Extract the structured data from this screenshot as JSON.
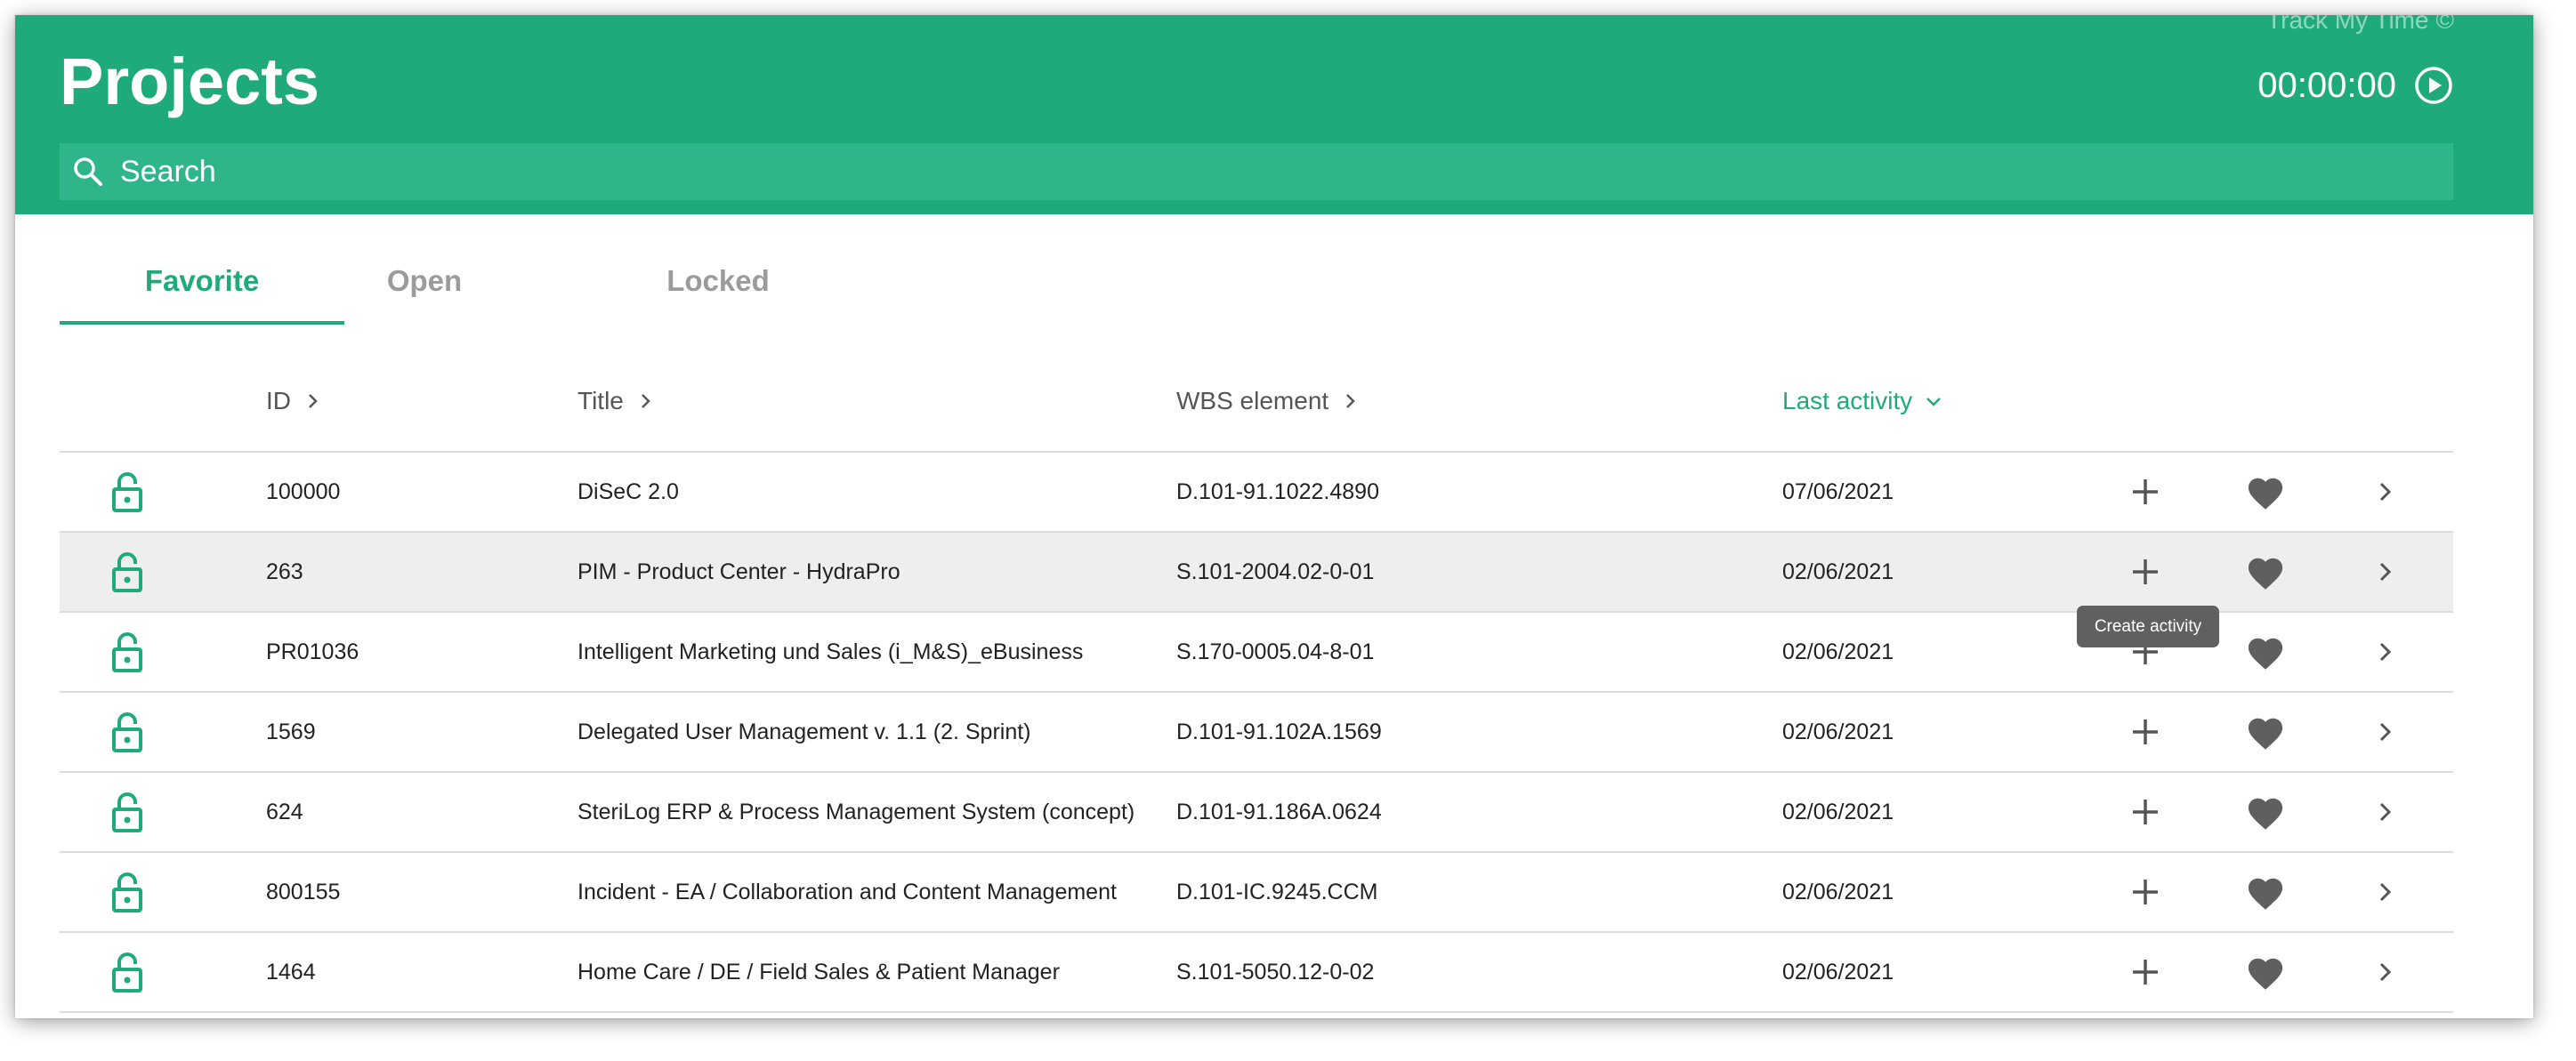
{
  "app": {
    "name": "Track My Time ©",
    "title": "Projects",
    "timer": "00:00:00",
    "accent_color": "#1fab79"
  },
  "search": {
    "placeholder": "Search",
    "value": ""
  },
  "tabs": [
    {
      "label": "Favorite",
      "active": true
    },
    {
      "label": "Open",
      "active": false
    },
    {
      "label": "Locked",
      "active": false
    }
  ],
  "table": {
    "columns": {
      "id": "ID",
      "title": "Title",
      "wbs": "WBS element",
      "last_activity": "Last activity"
    },
    "sorted_by": "last_activity",
    "rows": [
      {
        "id": "100000",
        "title": "DiSeC 2.0",
        "wbs": "D.101-91.1022.4890",
        "last_activity": "07/06/2021"
      },
      {
        "id": "263",
        "title": "PIM - Product Center - HydraPro",
        "wbs": "S.101-2004.02-0-01",
        "last_activity": "02/06/2021"
      },
      {
        "id": "PR01036",
        "title": "Intelligent Marketing und Sales (i_M&S)_eBusiness",
        "wbs": "S.170-0005.04-8-01",
        "last_activity": "02/06/2021"
      },
      {
        "id": "1569",
        "title": "Delegated User Management v. 1.1 (2. Sprint)",
        "wbs": "D.101-91.102A.1569",
        "last_activity": "02/06/2021"
      },
      {
        "id": "624",
        "title": "SteriLog ERP & Process Management System (concept)",
        "wbs": "D.101-91.186A.0624",
        "last_activity": "02/06/2021"
      },
      {
        "id": "800155",
        "title": "Incident - EA / Collaboration and Content Management",
        "wbs": "D.101-IC.9245.CCM",
        "last_activity": "02/06/2021"
      },
      {
        "id": "1464",
        "title": "Home Care / DE / Field Sales & Patient Manager",
        "wbs": "S.101-5050.12-0-02",
        "last_activity": "02/06/2021"
      }
    ]
  },
  "tooltip": {
    "text": "Create activity"
  },
  "icons": {
    "row_status": "unlock-icon",
    "add": "plus-icon",
    "favorite": "heart-icon",
    "open": "chevron-right-icon",
    "timer": "play-circle-icon",
    "search": "search-icon"
  }
}
